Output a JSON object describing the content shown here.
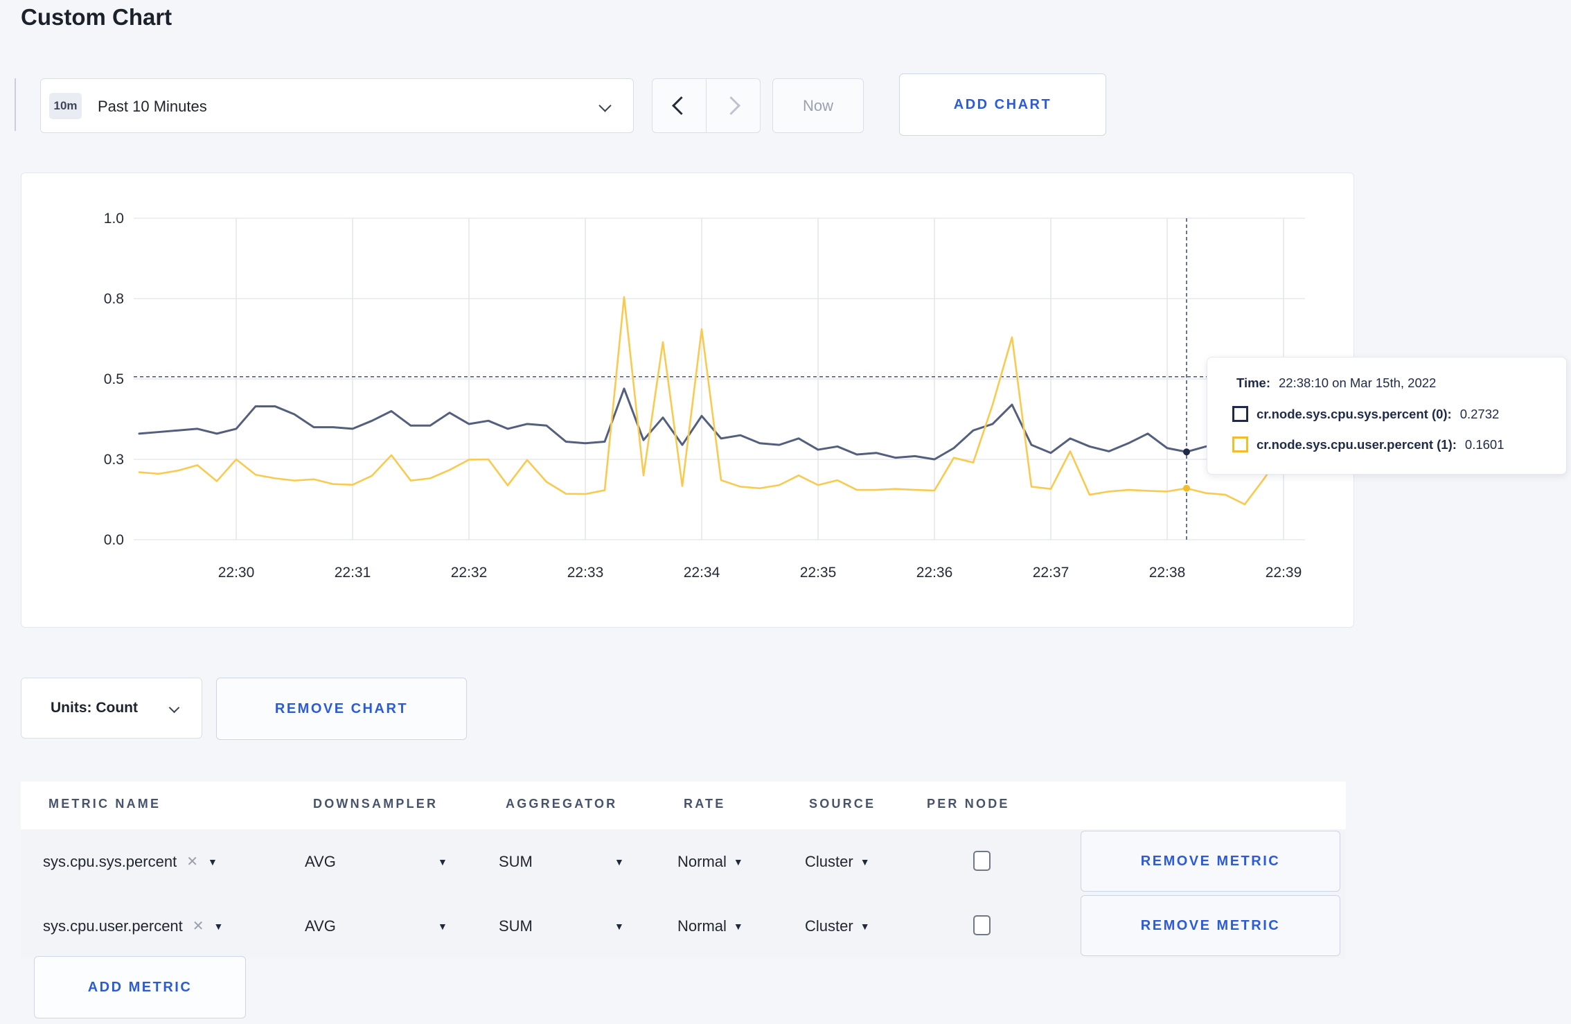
{
  "page_title": "Custom Chart",
  "accent_blue": "#2c5bd7",
  "glyphs": {
    "caret": "▼",
    "close": "✕"
  },
  "toolbar": {
    "range_badge": "10m",
    "range_label": "Past 10 Minutes",
    "now_label": "Now",
    "add_chart_label": "ADD CHART",
    "icons": {
      "range_dropdown": "chevron-down-icon",
      "prev": "chevron-left-icon",
      "next": "chevron-right-icon"
    }
  },
  "chart_data": {
    "type": "line",
    "title": "",
    "xlabel": "",
    "ylabel": "",
    "x_start": "22:29:10",
    "x_interval_seconds": 10,
    "x_tick_labels": [
      "22:30",
      "22:31",
      "22:32",
      "22:33",
      "22:34",
      "22:35",
      "22:36",
      "22:37",
      "22:38",
      "22:39"
    ],
    "x_first_tick_index": 5,
    "x_tick_every": 6,
    "ylim": [
      0,
      1
    ],
    "grid": true,
    "legend_position": "tooltip-only",
    "y_ticks": [
      {
        "value": 0.0,
        "label": "0.0"
      },
      {
        "value": 0.25,
        "label": "0.3"
      },
      {
        "value": 0.5,
        "label": "0.5"
      },
      {
        "value": 0.75,
        "label": "0.8"
      },
      {
        "value": 1.0,
        "label": "1.0"
      }
    ],
    "series": [
      {
        "name": "cr.node.sys.cpu.sys.percent (0)",
        "color": "#535f7d",
        "values": [
          0.33,
          0.335,
          0.34,
          0.345,
          0.33,
          0.345,
          0.415,
          0.415,
          0.39,
          0.35,
          0.35,
          0.345,
          0.37,
          0.4,
          0.355,
          0.355,
          0.395,
          0.36,
          0.37,
          0.345,
          0.36,
          0.355,
          0.305,
          0.3,
          0.305,
          0.47,
          0.31,
          0.38,
          0.295,
          0.385,
          0.315,
          0.325,
          0.3,
          0.295,
          0.315,
          0.28,
          0.29,
          0.265,
          0.27,
          0.255,
          0.26,
          0.25,
          0.285,
          0.34,
          0.36,
          0.42,
          0.295,
          0.27,
          0.315,
          0.29,
          0.275,
          0.3,
          0.33,
          0.285,
          0.2732,
          0.29,
          0.3,
          0.295,
          0.3,
          0.305,
          0.31
        ]
      },
      {
        "name": "cr.node.sys.cpu.user.percent (1)",
        "color": "#f8ca4f",
        "values": [
          0.21,
          0.205,
          0.215,
          0.232,
          0.182,
          0.25,
          0.202,
          0.191,
          0.184,
          0.188,
          0.173,
          0.171,
          0.199,
          0.263,
          0.184,
          0.191,
          0.217,
          0.249,
          0.25,
          0.169,
          0.248,
          0.18,
          0.143,
          0.142,
          0.154,
          0.755,
          0.2,
          0.615,
          0.167,
          0.655,
          0.185,
          0.165,
          0.16,
          0.17,
          0.2,
          0.17,
          0.185,
          0.155,
          0.155,
          0.158,
          0.155,
          0.153,
          0.255,
          0.24,
          0.42,
          0.63,
          0.165,
          0.158,
          0.275,
          0.14,
          0.15,
          0.155,
          0.152,
          0.15,
          0.1601,
          0.145,
          0.14,
          0.11,
          0.19,
          0.28,
          0.26
        ]
      }
    ],
    "crosshair": {
      "index": 54,
      "time": "22:38:10",
      "hline_value": 0.507
    }
  },
  "tooltip": {
    "time_label": "Time:",
    "time_value": "22:38:10 on Mar 15th, 2022",
    "series": [
      {
        "label": "cr.node.sys.cpu.sys.percent (0):",
        "value": "0.2732",
        "swatch": "#1f2a48"
      },
      {
        "label": "cr.node.sys.cpu.user.percent (1):",
        "value": "0.1601",
        "swatch": "#f1bd2a"
      }
    ]
  },
  "units_bar": {
    "units_label": "Units: Count",
    "remove_chart_label": "REMOVE CHART"
  },
  "metrics_table": {
    "columns": [
      "METRIC NAME",
      "DOWNSAMPLER",
      "AGGREGATOR",
      "RATE",
      "SOURCE",
      "PER NODE"
    ],
    "rows": [
      {
        "name": "sys.cpu.sys.percent",
        "downsampler": "AVG",
        "aggregator": "SUM",
        "rate": "Normal",
        "source": "Cluster",
        "per_node": false
      },
      {
        "name": "sys.cpu.user.percent",
        "downsampler": "AVG",
        "aggregator": "SUM",
        "rate": "Normal",
        "source": "Cluster",
        "per_node": false
      }
    ],
    "remove_metric_label": "REMOVE METRIC",
    "add_metric_label": "ADD METRIC"
  }
}
